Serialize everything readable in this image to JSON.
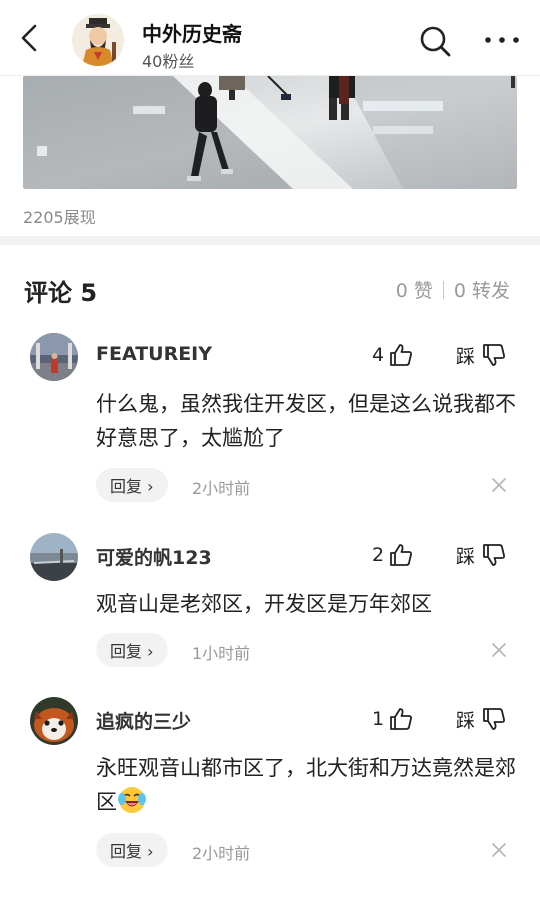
{
  "header": {
    "account_name": "中外历史斋",
    "fans": "40粉丝",
    "icons": {
      "back": "chevron-left-icon",
      "search": "search-icon",
      "more": "more-dots-icon"
    }
  },
  "post": {
    "image": "photo of people walking on a reflective mall floor",
    "views": "2205展现"
  },
  "comments_section": {
    "title": "评论 5",
    "likes": "0 赞",
    "shares": "0 转发"
  },
  "comments": [
    {
      "username": "FEATUREIY",
      "likes": "4",
      "dislike_label": "踩",
      "text": "什么鬼，虽然我住开发区，但是这么说我都不好意思了，太尴尬了",
      "reply_label": "回复 ›",
      "time": "2小时前"
    },
    {
      "username": "可爱的帆123",
      "likes": "2",
      "dislike_label": "踩",
      "text": "观音山是老郊区，开发区是万年郊区",
      "reply_label": "回复 ›",
      "time": "1小时前"
    },
    {
      "username": "追疯的三少",
      "likes": "1",
      "dislike_label": "踩",
      "text": "永旺观音山都市区了，北大街和万达竟然是郊区",
      "reply_label": "回复 ›",
      "time": "2小时前"
    }
  ],
  "colors": {
    "text_primary": "#222222",
    "text_muted": "#9a9a9a",
    "pill_bg": "#f2f2f2",
    "divider": "#f2f2f2"
  }
}
